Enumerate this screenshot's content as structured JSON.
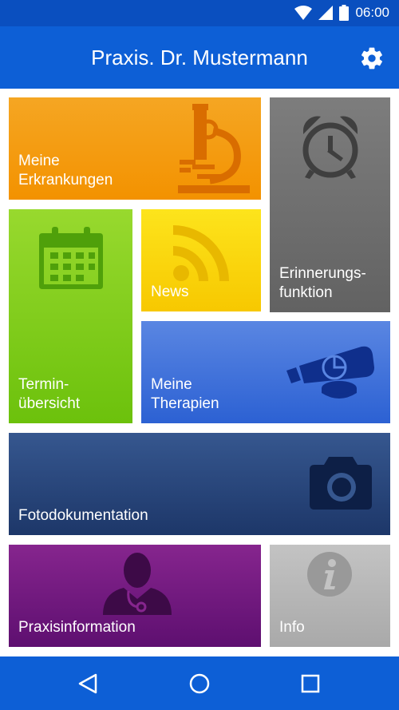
{
  "status_bar": {
    "time": "06:00",
    "icons": [
      "wifi-icon",
      "cell-signal-icon",
      "battery-icon"
    ]
  },
  "app_bar": {
    "title": "Praxis. Dr. Mustermann",
    "action_icon": "gear-icon"
  },
  "tiles": [
    {
      "id": "erkrankungen",
      "label": "Meine\nErkrankungen",
      "icon": "microscope-icon",
      "color": "#f39200"
    },
    {
      "id": "erinnerung",
      "label": "Erinnerungs-\nfunktion",
      "icon": "alarm-clock-icon",
      "color": "#6e6e6e"
    },
    {
      "id": "termin",
      "label": "Termin-\nübersicht",
      "icon": "calendar-icon",
      "color": "#7ec81a"
    },
    {
      "id": "news",
      "label": "News",
      "icon": "rss-icon",
      "color": "#f9d00c"
    },
    {
      "id": "therapien",
      "label": "Meine\nTherapien",
      "icon": "medication-icon",
      "color": "#3b6fd9"
    },
    {
      "id": "foto",
      "label": "Fotodokumentation",
      "icon": "camera-icon",
      "color": "#253f73"
    },
    {
      "id": "praxis",
      "label": "Praxisinformation",
      "icon": "doctor-icon",
      "color": "#6e1880"
    },
    {
      "id": "info",
      "label": "Info",
      "icon": "info-icon",
      "color": "#b5b5b5"
    }
  ],
  "nav_bar": {
    "buttons": [
      "back-icon",
      "home-icon",
      "recents-icon"
    ]
  },
  "colors": {
    "status_bar": "#0a4fbf",
    "app_bar": "#0d5fd6",
    "background": "#ffffff"
  }
}
